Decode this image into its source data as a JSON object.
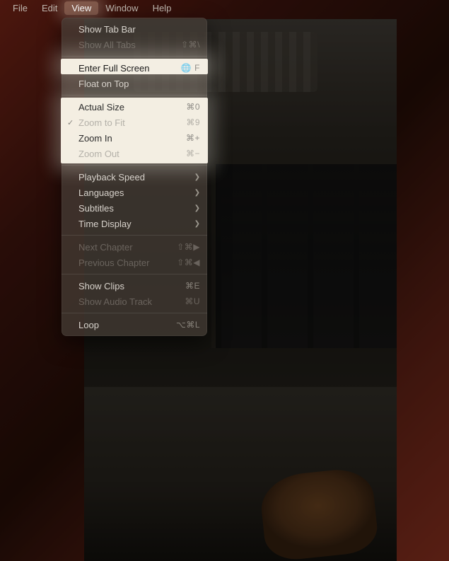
{
  "menubar": {
    "items": [
      {
        "label": "File"
      },
      {
        "label": "Edit"
      },
      {
        "label": "View",
        "active": true
      },
      {
        "label": "Window"
      },
      {
        "label": "Help"
      }
    ]
  },
  "view_menu": {
    "groups": [
      [
        {
          "label": "Show Tab Bar",
          "shortcut": "",
          "enabled": true
        },
        {
          "label": "Show All Tabs",
          "shortcut": "⇧⌘\\",
          "enabled": false
        }
      ],
      [
        {
          "label": "Enter Full Screen",
          "shortcut": "🌐 F",
          "enabled": true,
          "hovered": true
        },
        {
          "label": "Float on Top",
          "shortcut": "",
          "enabled": true
        }
      ],
      [
        {
          "label": "Actual Size",
          "shortcut": "⌘0",
          "enabled": true
        },
        {
          "label": "Zoom to Fit",
          "shortcut": "⌘9",
          "enabled": false,
          "checked": true
        },
        {
          "label": "Zoom In",
          "shortcut": "⌘+",
          "enabled": true
        },
        {
          "label": "Zoom Out",
          "shortcut": "⌘−",
          "enabled": false
        }
      ],
      [
        {
          "label": "Playback Speed",
          "submenu": true,
          "enabled": true
        },
        {
          "label": "Languages",
          "submenu": true,
          "enabled": true
        },
        {
          "label": "Subtitles",
          "submenu": true,
          "enabled": true
        },
        {
          "label": "Time Display",
          "submenu": true,
          "enabled": true
        }
      ],
      [
        {
          "label": "Next Chapter",
          "shortcut": "⇧⌘▶",
          "enabled": false
        },
        {
          "label": "Previous Chapter",
          "shortcut": "⇧⌘◀",
          "enabled": false
        }
      ],
      [
        {
          "label": "Show Clips",
          "shortcut": "⌘E",
          "enabled": true
        },
        {
          "label": "Show Audio Track",
          "shortcut": "⌘U",
          "enabled": false
        }
      ],
      [
        {
          "label": "Loop",
          "shortcut": "⌥⌘L",
          "enabled": true
        }
      ]
    ]
  }
}
